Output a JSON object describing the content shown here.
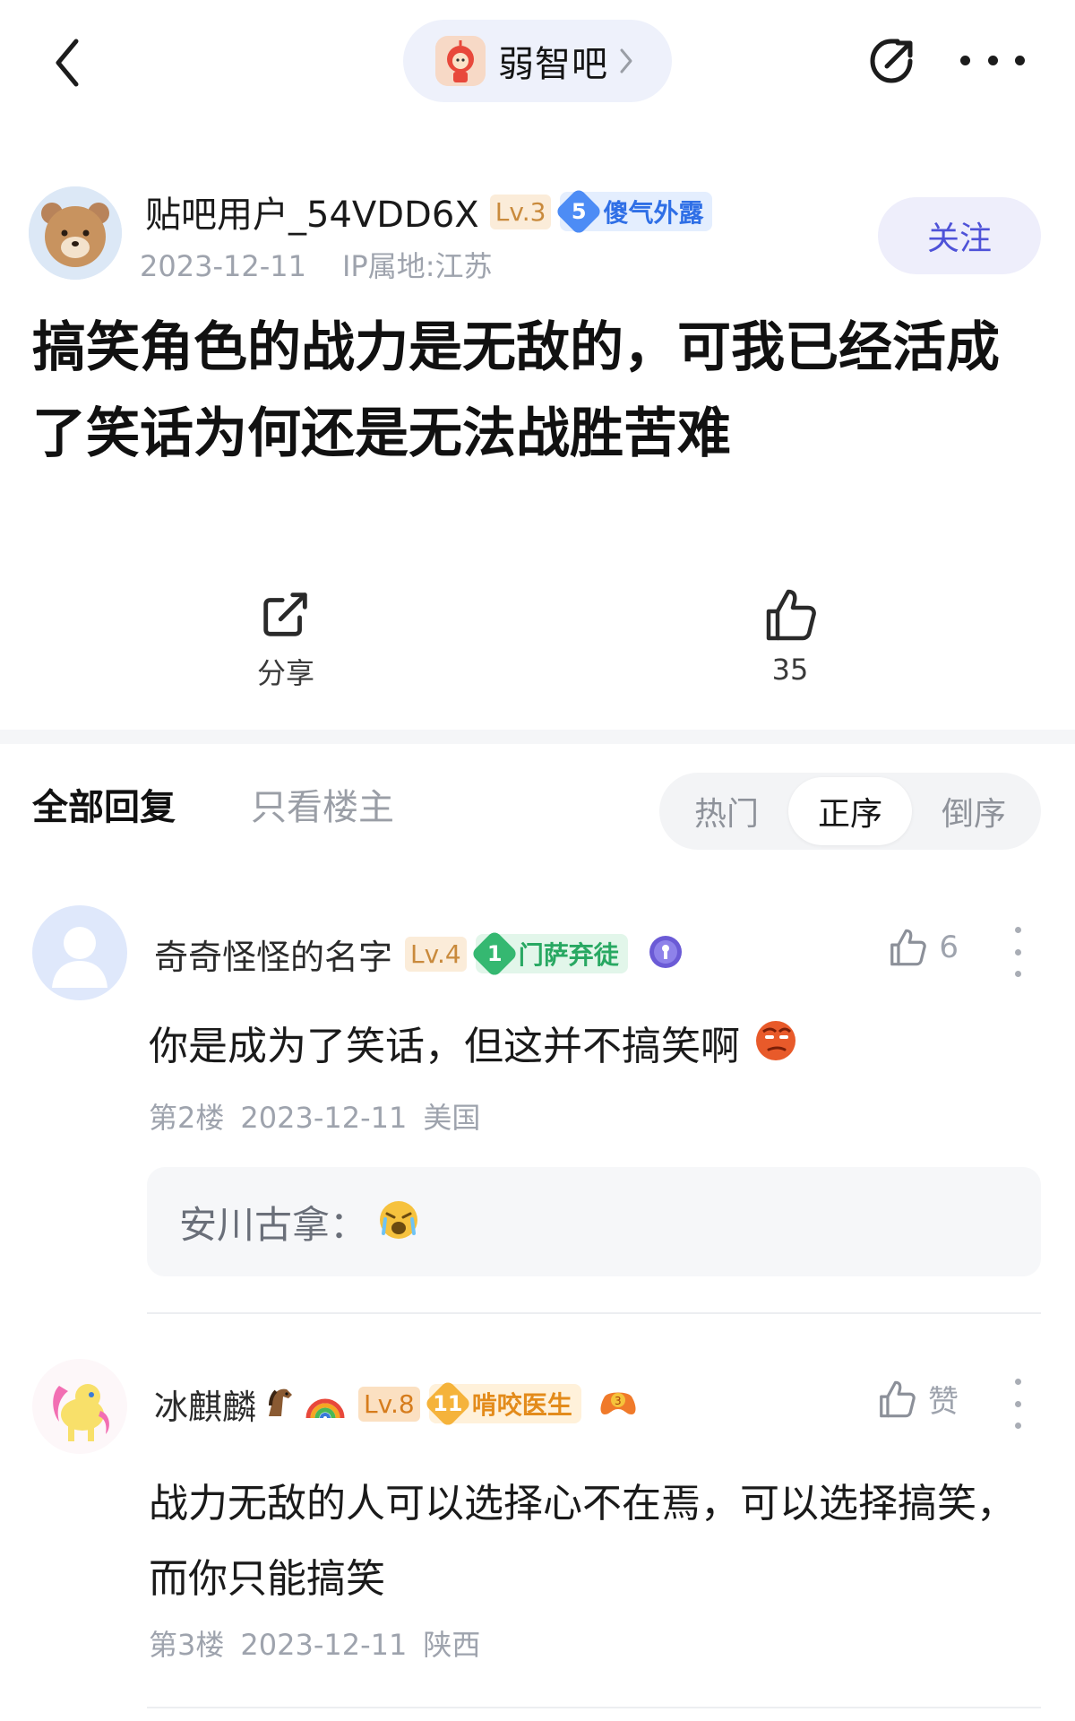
{
  "nav": {
    "forum_name": "弱智吧"
  },
  "post": {
    "author": {
      "name": "贴吧用户_54VDD6X",
      "level": "Lv.3",
      "title_level": "5",
      "title": "傻气外露",
      "date": "2023-12-11",
      "ip": "IP属地:江苏"
    },
    "follow_label": "关注",
    "title": "搞笑角色的战力是无敌的，可我已经活成了笑话为何还是无法战胜苦难",
    "share_label": "分享",
    "like_count": "35"
  },
  "tabs": {
    "all": "全部回复",
    "op_only": "只看楼主",
    "sort": [
      "热门",
      "正序",
      "倒序"
    ],
    "active_sort": "正序"
  },
  "replies": [
    {
      "name": "奇奇怪怪的名字",
      "level": "Lv.4",
      "title_level": "1",
      "title": "门萨弃徒",
      "likes": "6",
      "text": "你是成为了笑话，但这并不搞笑啊",
      "floor": "第2楼",
      "date": "2023-12-11",
      "location": "美国",
      "sub_reply": {
        "name": "安川古拿："
      }
    },
    {
      "name": "冰麒麟",
      "level": "Lv.8",
      "title_level": "11",
      "title": "啃咬医生",
      "likes": "赞",
      "text": "战力无敌的人可以选择心不在焉，可以选择搞笑，而你只能搞笑",
      "floor": "第3楼",
      "date": "2023-12-11",
      "location": "陕西"
    }
  ],
  "colors": {
    "accent": "#4e52d8",
    "pill_bg": "#eef1fb",
    "muted_text": "#9ea3ad"
  }
}
